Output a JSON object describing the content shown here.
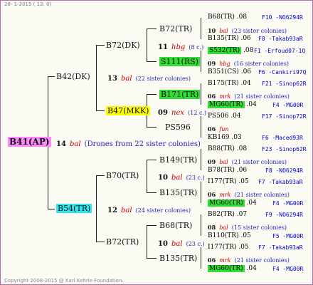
{
  "header": "28-  1-2015 ( 12: 0)",
  "footer": "Copyright 2008-2015 @ Karl Kehrle Foundation.",
  "root": {
    "name": "B41(AP)",
    "count": "14",
    "label": "bal",
    "note": "(Drones from 22 sister colonies)"
  },
  "sire_top": {
    "name": "B42(DK)",
    "count": "13",
    "label": "bal",
    "note": "(22 sister colonies)"
  },
  "sire_bottom": {
    "name": "B54(TR)",
    "count": "12",
    "label": "bal",
    "note": "(24 sister colonies)"
  },
  "l2": [
    {
      "name": "B72(DK)",
      "count": "11",
      "label": "hbg",
      "note": "(8 c.)"
    },
    {
      "name": "B47(MKK)",
      "count": "09",
      "label": "nex",
      "note": "(12 c.)"
    },
    {
      "name": "B70(TR)",
      "count": "10",
      "label": "bal",
      "note": "(23 c.)"
    },
    {
      "name": "B72(TR)",
      "count": "10",
      "label": "bal",
      "note": "(23 c.)"
    }
  ],
  "l3": [
    {
      "name": "B72(TR)",
      "count": "10",
      "label": "bal",
      "note": "(23 sister colonies)"
    },
    {
      "name": "S111(RS)",
      "count": "09",
      "label": "hbg",
      "note": "(16 sister colonies)"
    },
    {
      "name": "B171(TR)",
      "count": "06",
      "label": "mrk",
      "note": "(21 sister colonies)"
    },
    {
      "name": "PS596",
      "count": "06",
      "label": "fun",
      "note": ""
    },
    {
      "name": "B149(TR)",
      "count": "09",
      "label": "bal",
      "note": "(21 sister colonies)"
    },
    {
      "name": "B135(TR)",
      "count": "06",
      "label": "mrk",
      "note": "(21 sister colonies)"
    },
    {
      "name": "B68(TR)",
      "count": "08",
      "label": "bal",
      "note": "(15 sister colonies)"
    },
    {
      "name": "B135(TR)",
      "count": "06",
      "label": "mrk",
      "note": "(21 sister colonies)"
    }
  ],
  "leaves": [
    {
      "name": "B68(TR)",
      "v": ".08",
      "id": "F10 -NO6294R"
    },
    {
      "name": "B135(TR)",
      "v": ".06",
      "id": "F8 -Takab93aR"
    },
    {
      "name": "S532(TR)",
      "v": ".08",
      "id": "F1 -Erfoud07-1Q"
    },
    {
      "name": "B351(CS)",
      "v": ".06",
      "id": "F6 -Cankiri97Q"
    },
    {
      "name": "B175(TR)",
      "v": ".04",
      "id": "F21 -Sinop62R"
    },
    {
      "name": "MG60(TR)",
      "v": ".04",
      "id": "F4 -MG00R"
    },
    {
      "name": "PS506",
      "v": ".04",
      "id": "F17 -Sinop72R"
    },
    {
      "name": "KB169",
      "v": ".03",
      "id": "F6 -Maced93R"
    },
    {
      "name": "B88(TR)",
      "v": ".08",
      "id": "F23 -Sinop62R"
    },
    {
      "name": "B78(TR)",
      "v": ".06",
      "id": "F8 -NO6294R"
    },
    {
      "name": "I177(TR)",
      "v": ".05",
      "id": "F7 -Takab93aR"
    },
    {
      "name": "MG60(TR)",
      "v": ".04",
      "id": "F4 -MG00R"
    },
    {
      "name": "B82(TR)",
      "v": ".07",
      "id": "F9 -NO6294R"
    },
    {
      "name": "B110(TR)",
      "v": ".05",
      "id": "F5 -MG00R"
    },
    {
      "name": "I177(TR)",
      "v": ".05",
      "id": "F7 -Takab93aR"
    },
    {
      "name": "MG60(TR)",
      "v": ".04",
      "id": "F4 -MG00R"
    }
  ],
  "colors": {
    "pink": "#ff88ff",
    "cyan": "#33e6ef",
    "yellow": "#ffff00",
    "green": "#33dd33",
    "link": "#0000cc",
    "label": "#cc0000"
  }
}
